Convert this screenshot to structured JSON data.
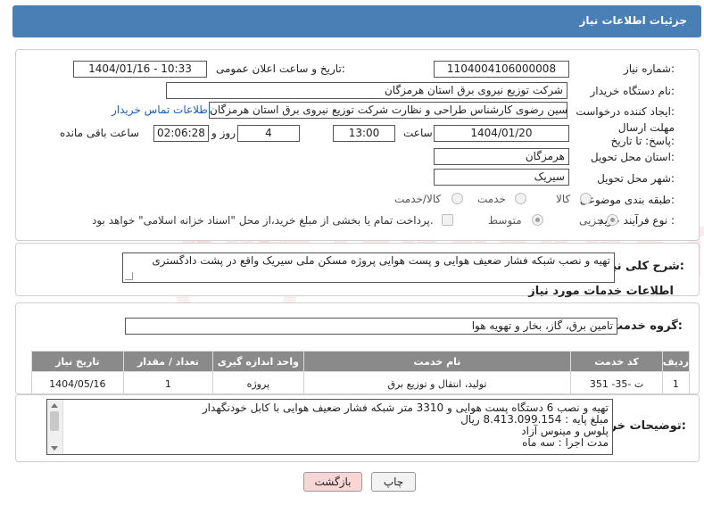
{
  "header": {
    "title": "جزئیات اطلاعات نیاز"
  },
  "form": {
    "need_number_label": "شماره نیاز:",
    "need_number": "1104004106000008",
    "announce_label": "تاریخ و ساعت اعلان عمومی:",
    "announce_value": "1404/01/16 - 10:33",
    "buyer_org_label": "نام دستگاه خریدار:",
    "buyer_org": "شرکت توزیع نیروی برق استان هرمزگان",
    "requester_label": "ایجاد کننده درخواست:",
    "requester": "سیدحسین رضوی کارشناس طراحی و نظارت شرکت توزیع نیروی برق استان هرمزگان",
    "contact_link": "اطلاعات تماس خریدار",
    "deadline_label": "مهلت ارسال پاسخ: تا تاریخ:",
    "deadline_date": "1404/01/20",
    "time_label": "ساعت",
    "deadline_time": "13:00",
    "days_value": "4",
    "days_label": "روز و",
    "remaining_time": "02:06:28",
    "remaining_label": "ساعت باقی مانده",
    "province_label": "استان محل تحویل:",
    "province": "هرمزگان",
    "city_label": "شهر محل تحویل:",
    "city": "سیریک",
    "category_label": "طبقه بندی موضوعی:",
    "category_options": [
      "کالا",
      "خدمت",
      "کالا/خدمت"
    ],
    "category_selected": "خدمت",
    "process_label": "نوع فرآیند خرید :",
    "process_options": [
      "جزیی",
      "متوسط"
    ],
    "process_selected": "جزیی",
    "payment_note": "پرداخت تمام یا بخشی از مبلغ خرید،از محل \"اسناد خزانه اسلامی\" خواهد بود."
  },
  "summary": {
    "label": "شرح کلی نیاز:",
    "text": "تهیه  و نصب شبکه فشار ضعیف هوایی و پست هوایی  پروژه مسکن ملی سیریک واقع در پشت دادگستری"
  },
  "services": {
    "section_title": "اطلاعات خدمات مورد نیاز",
    "group_label": "گروه خدمت:",
    "group_value": "تامین برق، گاز، بخار و تهویه هوا",
    "columns": [
      "ردیف",
      "کد خدمت",
      "نام خدمت",
      "واحد اندازه گیری",
      "تعداد / مقدار",
      "تاریخ نیاز"
    ],
    "rows": [
      [
        "1",
        "ت -35- 351",
        "تولید، انتقال و توزیع برق",
        "پروژه",
        "1",
        "1404/05/16"
      ]
    ]
  },
  "buyer_notes": {
    "label": "توضیحات خریدار:",
    "lines": [
      "تهیه و نصب 6 دستگاه پست هوایی و 3310 متر شبکه فشار ضعیف هوایی با کابل خودنگهدار",
      "مبلغ پایه : 8.413.099.154 ریال",
      "پلوس و مینوس آزاد",
      "مدت اجرا : سه ماه"
    ]
  },
  "buttons": {
    "print": "چاپ",
    "back": "بازگشت"
  },
  "watermark": "AriaTender.neT"
}
